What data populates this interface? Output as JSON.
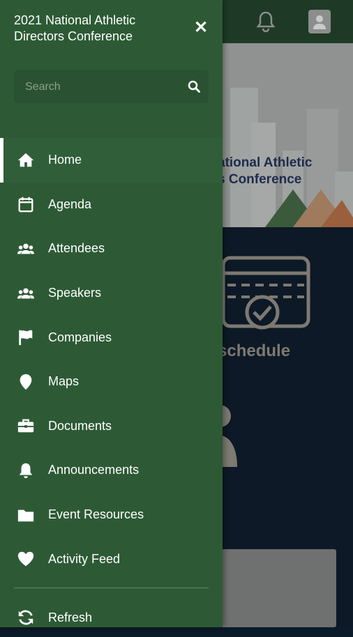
{
  "background": {
    "banner_title_line1": "ational Athletic",
    "banner_title_line2": "s Conference",
    "schedule_label": "schedule"
  },
  "drawer": {
    "title": "2021 National Athletic Directors Conference",
    "close_glyph": "✕",
    "search": {
      "placeholder": "Search",
      "value": ""
    },
    "items": [
      {
        "label": "Home",
        "icon": "home-icon",
        "active": true
      },
      {
        "label": "Agenda",
        "icon": "calendar-icon"
      },
      {
        "label": "Attendees",
        "icon": "users-icon"
      },
      {
        "label": "Speakers",
        "icon": "users-icon"
      },
      {
        "label": "Companies",
        "icon": "flag-icon"
      },
      {
        "label": "Maps",
        "icon": "map-pin-icon"
      },
      {
        "label": "Documents",
        "icon": "briefcase-icon"
      },
      {
        "label": "Announcements",
        "icon": "bell-icon"
      },
      {
        "label": "Event Resources",
        "icon": "folder-icon"
      },
      {
        "label": "Activity Feed",
        "icon": "heart-icon"
      }
    ],
    "refresh": {
      "label": "Refresh",
      "icon": "refresh-icon"
    }
  },
  "colors": {
    "drawer_bg": "#2d5a35",
    "header_bg": "#1e3a26",
    "text": "#ffffff"
  }
}
